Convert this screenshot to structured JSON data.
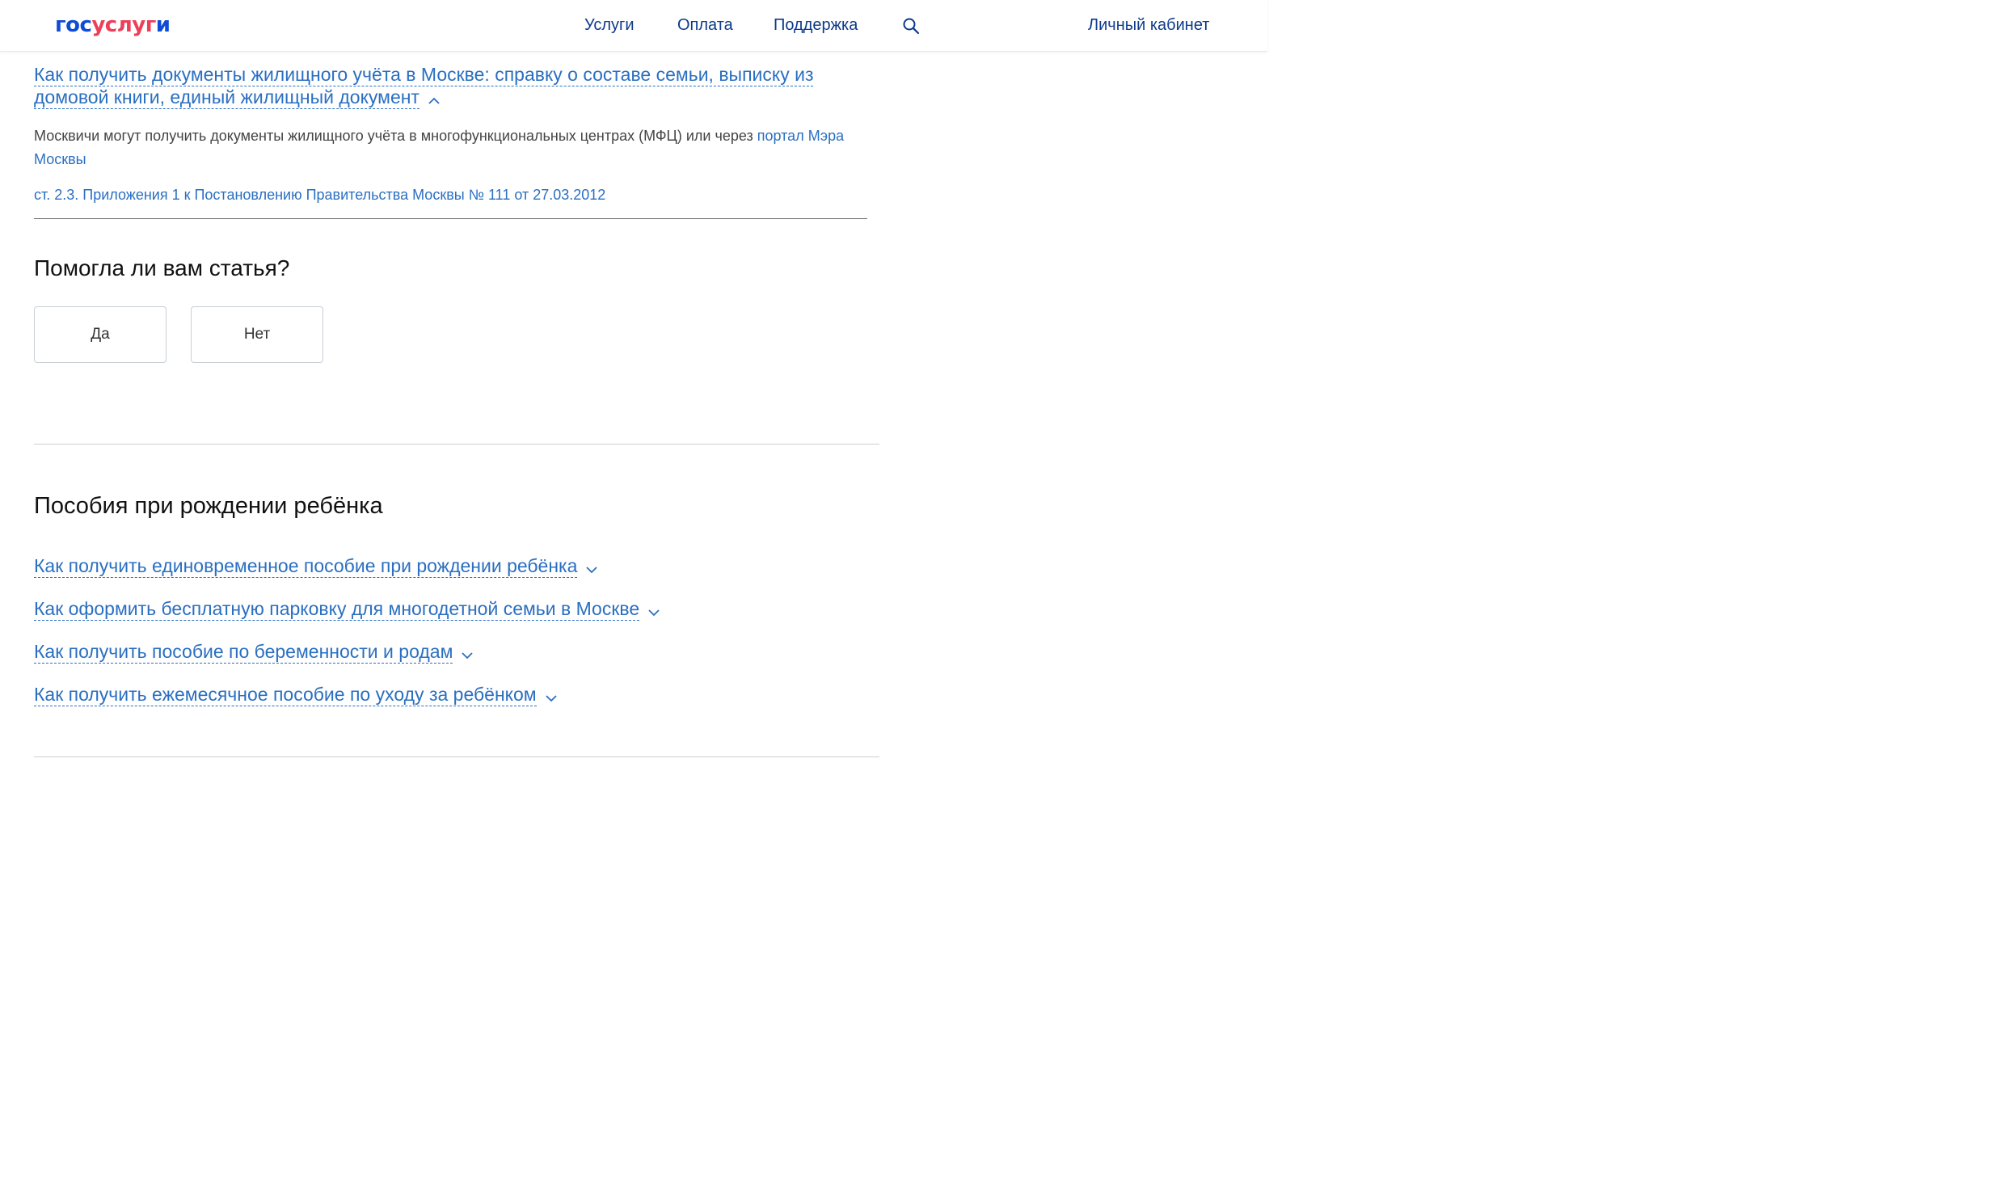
{
  "header": {
    "logo": {
      "part1": "гос",
      "part2": "услуг",
      "part3": "и"
    },
    "nav": {
      "services": "Услуги",
      "payment": "Оплата",
      "support": "Поддержка",
      "account": "Личный кабинет"
    },
    "search_icon": "search-icon"
  },
  "article": {
    "accordion_title_line1": "Как получить документы жилищного учёта в Москве: справку о составе семьи, выписку из",
    "accordion_title_line2": "домовой книги, единый жилищный документ",
    "description": "Москвичи могут получить документы жилищного учёта в многофункциональных центрах (МФЦ) или через ",
    "description_link": "портал Мэра Москвы",
    "law_link": "ст. 2.3. Приложения 1 к Постановлению Правительства Москвы № 111 от 27.03.2012"
  },
  "feedback": {
    "question": "Помогла ли вам статья?",
    "yes": "Да",
    "no": "Нет"
  },
  "section": {
    "title": "Пособия при рождении ребёнка",
    "items": [
      {
        "label": "Как получить единовременное пособие при рождении ребёнка"
      },
      {
        "label": "Как оформить бесплатную парковку для многодетной семьи в Москве"
      },
      {
        "label": "Как получить пособие по беременности и родам"
      },
      {
        "label": "Как получить ежемесячное пособие по уходу за ребёнком"
      }
    ]
  },
  "colors": {
    "link": "#2a6fc1",
    "nav": "#0d3a8a",
    "logo_blue": "#0d4cd3",
    "logo_red": "#ee3f58"
  }
}
